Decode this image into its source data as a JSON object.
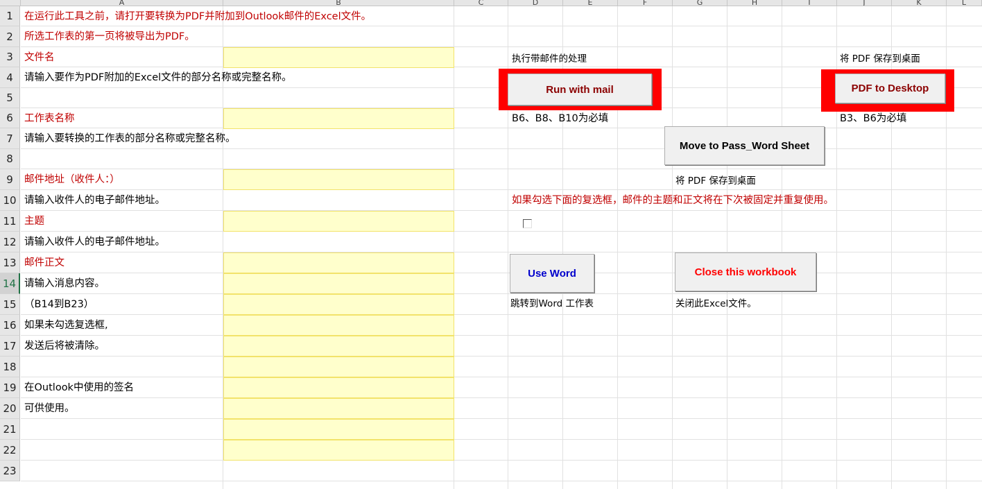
{
  "column_headers": [
    "A",
    "B",
    "C",
    "D",
    "E",
    "F",
    "G",
    "H",
    "I",
    "J",
    "K",
    "L"
  ],
  "row_headers": [
    "1",
    "2",
    "3",
    "4",
    "5",
    "6",
    "7",
    "8",
    "9",
    "10",
    "11",
    "12",
    "13",
    "14",
    "15",
    "16",
    "17",
    "18",
    "19",
    "20",
    "21",
    "22",
    "23"
  ],
  "selected_row": "14",
  "sheet_text": {
    "note1": "在运行此工具之前，请打开要转换为PDF并附加到Outlook邮件的Excel文件。",
    "note2": "所选工作表的第一页将被导出为PDF。",
    "file_name_label": "文件名",
    "file_name_help": "请输入要作为PDF附加的Excel文件的部分名称或完整名称。",
    "sheet_name_label": "工作表名称",
    "sheet_name_help": "请输入要转换的工作表的部分名称或完整名称。",
    "mail_to_label": "邮件地址（收件人：）",
    "mail_to_help": "请输入收件人的电子邮件地址。",
    "subject_label": "主题",
    "subject_help": "请输入收件人的电子邮件地址。",
    "body_label": "邮件正文",
    "body_help1": "请输入消息内容。",
    "body_help2": "（B14到B23）",
    "body_help3": "如果未勾选复选框,",
    "body_help4": "发送后将被清除。",
    "signature1": "在Outlook中使用的签名",
    "signature2": "可供使用。"
  },
  "panel": {
    "run_caption": "执行带邮件的处理",
    "run_mail_button": "Run with mail",
    "run_required": "B6、B8、B10为必填",
    "pdf_caption": "将 PDF 保存到桌面",
    "pdf_desktop_button": "PDF to Desktop",
    "pdf_required": "B3、B6为必填",
    "move_button": "Move to Pass_Word Sheet",
    "move_caption": "将 PDF 保存到桌面",
    "checkbox_note": "如果勾选下面的复选框，邮件的主题和正文将在下次被固定并重复使用。",
    "use_word_button": "Use Word",
    "use_word_caption": "跳转到Word 工作表",
    "close_button": "Close this workbook",
    "close_caption": "关闭此Excel文件。"
  },
  "colors": {
    "accent_red": "#c00000",
    "frame_red": "#ff0000",
    "input_fill": "#ffffcc",
    "use_word_text": "#0000cc",
    "close_text": "#ff0000",
    "run_text": "#8b0000"
  }
}
